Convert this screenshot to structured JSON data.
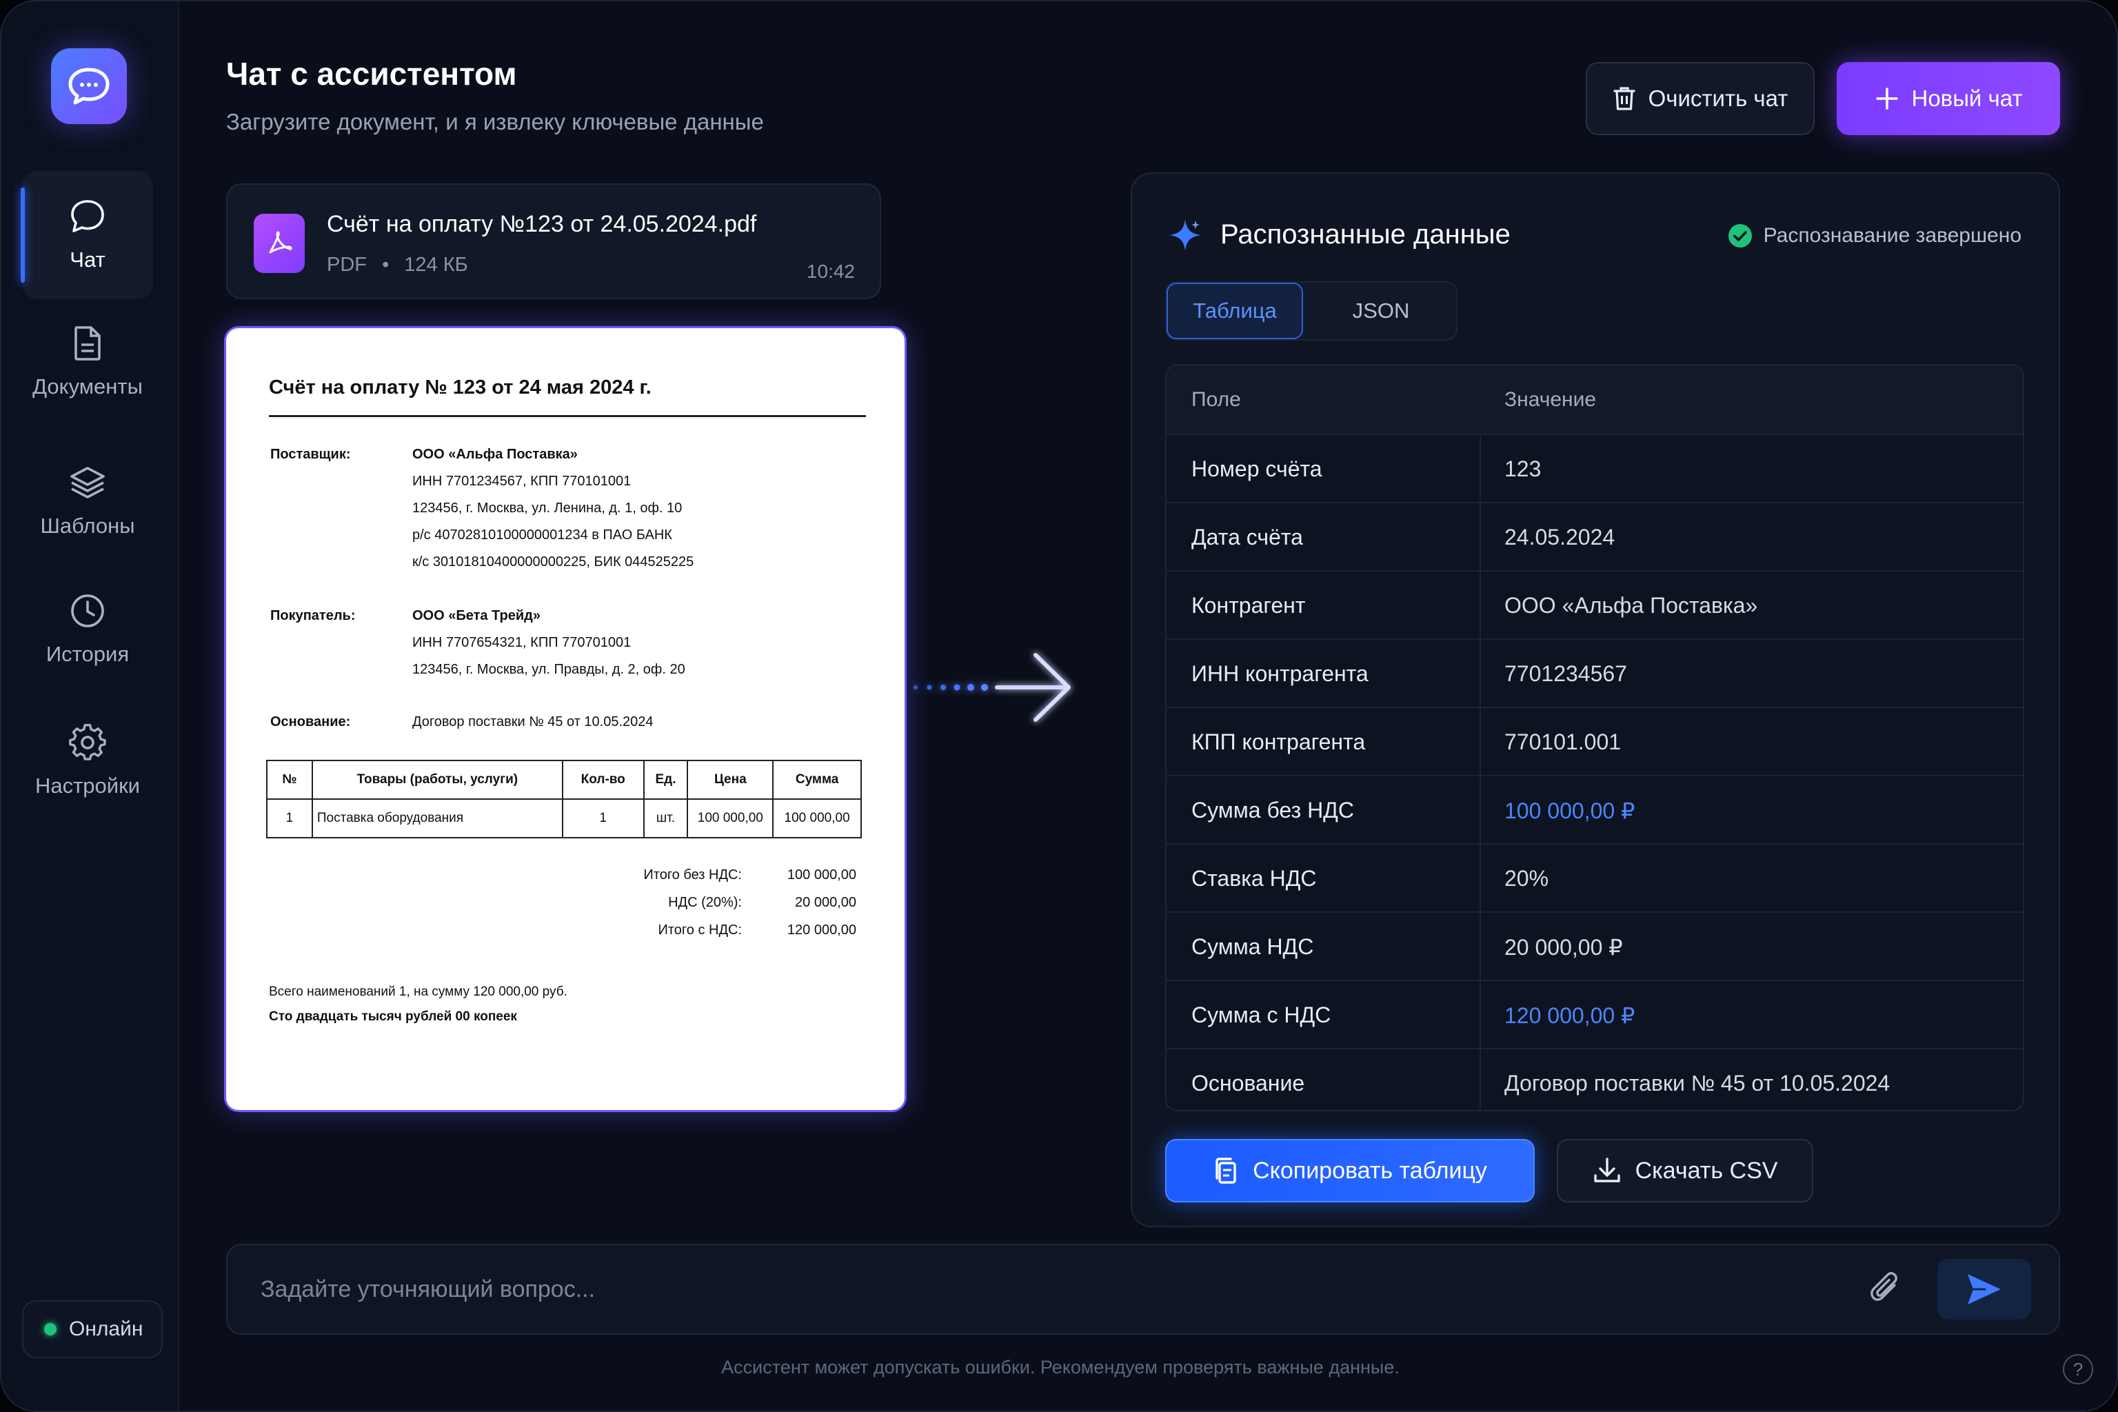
{
  "sidebar": {
    "logo_icon": "chat-bubble-icon",
    "items": [
      {
        "label": "Чат",
        "icon": "chat-icon",
        "active": true
      },
      {
        "label": "Документы",
        "icon": "document-icon"
      },
      {
        "label": "Шаблоны",
        "icon": "layers-icon"
      },
      {
        "label": "История",
        "icon": "clock-icon"
      },
      {
        "label": "Настройки",
        "icon": "gear-icon"
      }
    ],
    "status": "Онлайн"
  },
  "header": {
    "title": "Чат с ассистентом",
    "subtitle": "Загрузите документ, и я извлеку ключевые данные",
    "clear_label": "Очистить чат",
    "new_label": "Новый чат"
  },
  "file": {
    "name": "Счёт на оплату №123 от 24.05.2024.pdf",
    "type": "PDF",
    "size": "124 КБ",
    "time": "10:42"
  },
  "invoice": {
    "title": "Счёт на оплату № 123 от 24 мая 2024 г.",
    "supplier_label": "Поставщик:",
    "supplier": [
      "ООО «Альфа Поставка»",
      "ИНН 7701234567, КПП 770101001",
      "123456, г. Москва, ул. Ленина, д. 1, оф. 10",
      "р/с 40702810100000001234 в ПАО БАНК",
      "к/с 30101810400000000225, БИК 044525225"
    ],
    "buyer_label": "Покупатель:",
    "buyer": [
      "ООО «Бета Трейд»",
      "ИНН 7707654321, КПП 770701001",
      "123456, г. Москва, ул. Правды, д. 2, оф. 20"
    ],
    "basis_label": "Основание:",
    "basis": "Договор поставки № 45 от 10.05.2024",
    "table_headers": [
      "№",
      "Товары (работы, услуги)",
      "Кол-во",
      "Ед.",
      "Цена",
      "Сумма"
    ],
    "table_rows": [
      [
        "1",
        "Поставка оборудования",
        "1",
        "шт.",
        "100 000,00",
        "100 000,00"
      ]
    ],
    "totals": [
      {
        "label": "Итого без НДС:",
        "value": "100 000,00"
      },
      {
        "label": "НДС (20%):",
        "value": "20 000,00"
      },
      {
        "label": "Итого с НДС:",
        "value": "120 000,00"
      }
    ],
    "footer1": "Всего наименований 1, на сумму 120 000,00 руб.",
    "footer2": "Сто двадцать тысяч рублей 00 копеек"
  },
  "result": {
    "title": "Распознанные данные",
    "status": "Распознавание завершено",
    "tabs": [
      "Таблица",
      "JSON"
    ],
    "col_field": "Поле",
    "col_value": "Значение",
    "rows": [
      {
        "field": "Номер счёта",
        "value": "123"
      },
      {
        "field": "Дата счёта",
        "value": "24.05.2024"
      },
      {
        "field": "Контрагент",
        "value": "ООО «Альфа Поставка»"
      },
      {
        "field": "ИНН контрагента",
        "value": "7701234567"
      },
      {
        "field": "КПП контрагента",
        "value": "770101.001"
      },
      {
        "field": "Сумма без НДС",
        "value": "100 000,00 ₽",
        "accent": true
      },
      {
        "field": "Ставка НДС",
        "value": "20%"
      },
      {
        "field": "Сумма НДС",
        "value": "20 000,00 ₽"
      },
      {
        "field": "Сумма с НДС",
        "value": "120 000,00 ₽",
        "accent": true
      },
      {
        "field": "Основание",
        "value": "Договор поставки № 45 от 10.05.2024"
      }
    ],
    "copy_label": "Скопировать таблицу",
    "csv_label": "Скачать CSV"
  },
  "composer": {
    "placeholder": "Задайте уточняющий вопрос...",
    "disclaimer": "Ассистент может допускать ошибки. Рекомендуем проверять важные данные.",
    "help": "?"
  },
  "colors": {
    "accent_blue": "#4b86ff",
    "accent_purple": "#8f48ff",
    "success": "#1fc27a"
  }
}
